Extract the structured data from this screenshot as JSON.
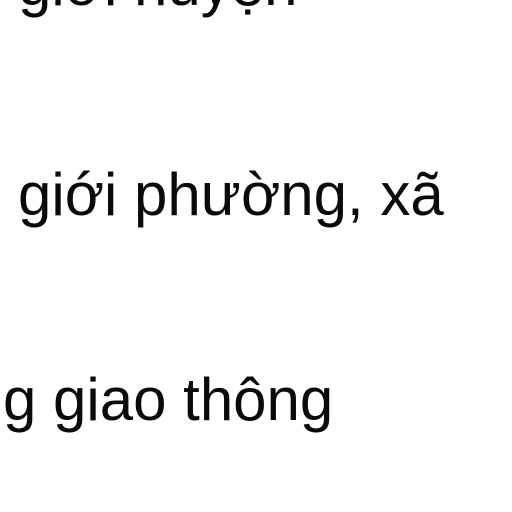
{
  "legend_lines": [
    {
      "text": "giới huyện"
    },
    {
      "text": "giới phường, xã"
    },
    {
      "text": "g giao thông"
    }
  ],
  "colors": {
    "background": "#ffffff",
    "text": "#0a0a0a"
  }
}
